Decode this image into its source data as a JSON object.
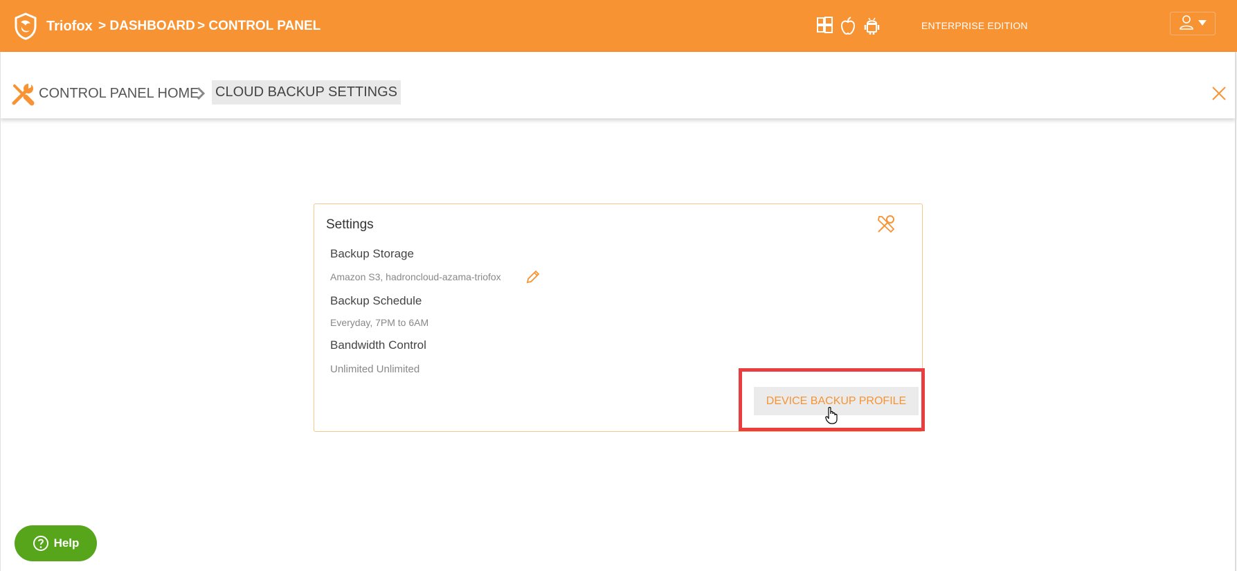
{
  "header": {
    "brand": "Triofox",
    "crumb_dashboard": "> DASHBOARD",
    "crumb_control_panel": "> CONTROL PANEL",
    "edition": "ENTERPRISE EDITION",
    "platform_icons": [
      "windows-icon",
      "apple-icon",
      "android-icon"
    ],
    "accent_color": "#f79333"
  },
  "breadcrumb": {
    "home": "CONTROL PANEL HOME",
    "current": "CLOUD BACKUP SETTINGS"
  },
  "settings_card": {
    "title": "Settings",
    "backup_storage_label": "Backup Storage",
    "backup_storage_value": "Amazon S3, hadroncloud-azama-triofox",
    "backup_schedule_label": "Backup Schedule",
    "backup_schedule_value": "Everyday, 7PM to 6AM",
    "bandwidth_label": "Bandwidth Control",
    "bandwidth_value": "Unlimited Unlimited",
    "profile_button": "DEVICE BACKUP PROFILE"
  },
  "help": {
    "label": "Help",
    "color": "#56a51a"
  },
  "highlight_color": "#ea3d3f"
}
